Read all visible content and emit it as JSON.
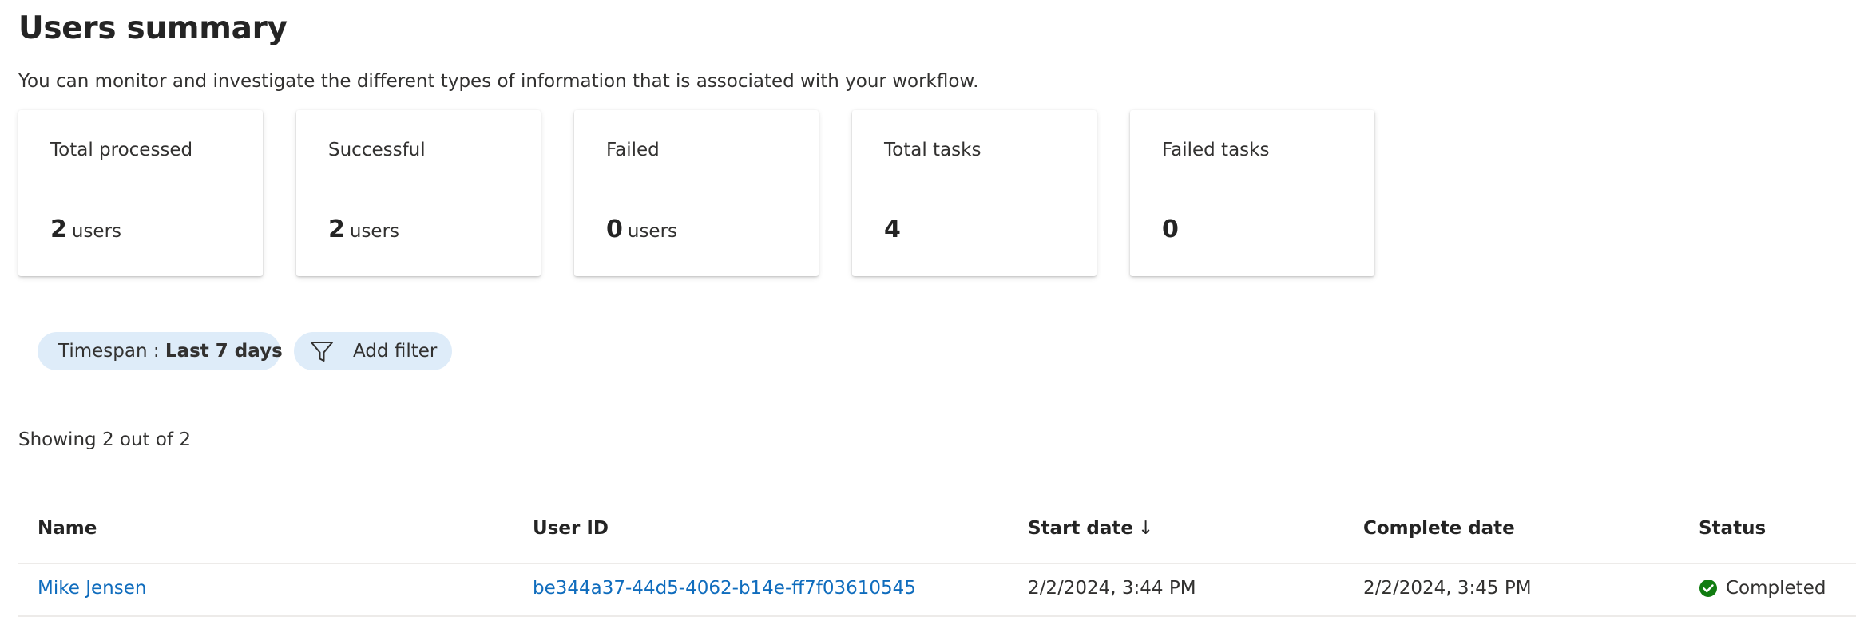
{
  "page": {
    "title": "Users summary",
    "description": "You can monitor and investigate the different types of information that is associated with your workflow."
  },
  "cards": [
    {
      "label": "Total processed",
      "value": "2",
      "unit": "users"
    },
    {
      "label": "Successful",
      "value": "2",
      "unit": "users"
    },
    {
      "label": "Failed",
      "value": "0",
      "unit": "users"
    },
    {
      "label": "Total tasks",
      "value": "4",
      "unit": ""
    },
    {
      "label": "Failed tasks",
      "value": "0",
      "unit": ""
    }
  ],
  "filters": {
    "timespan_label": "Timespan : ",
    "timespan_value": "Last 7 days",
    "add_filter_label": "Add filter",
    "add_filter_icon": "filter-icon"
  },
  "results": {
    "showing": "Showing 2 out of 2"
  },
  "table": {
    "columns": [
      "Name",
      "User ID",
      "Start date",
      "Complete date",
      "Status"
    ],
    "sort_indicator": "↓",
    "sorted_column": "Start date",
    "rows": [
      {
        "name": "Mike Jensen",
        "user_id": "be344a37-44d5-4062-b14e-ff7f03610545",
        "start_date": "2/2/2024, 3:44 PM",
        "complete_date": "2/2/2024, 3:45 PM",
        "status": "Completed",
        "status_icon": "check-circle-icon"
      }
    ]
  },
  "colors": {
    "link": "#0f6cbd",
    "pill_background": "#deecf9",
    "success": "#107c10",
    "divider": "#edebe9"
  }
}
